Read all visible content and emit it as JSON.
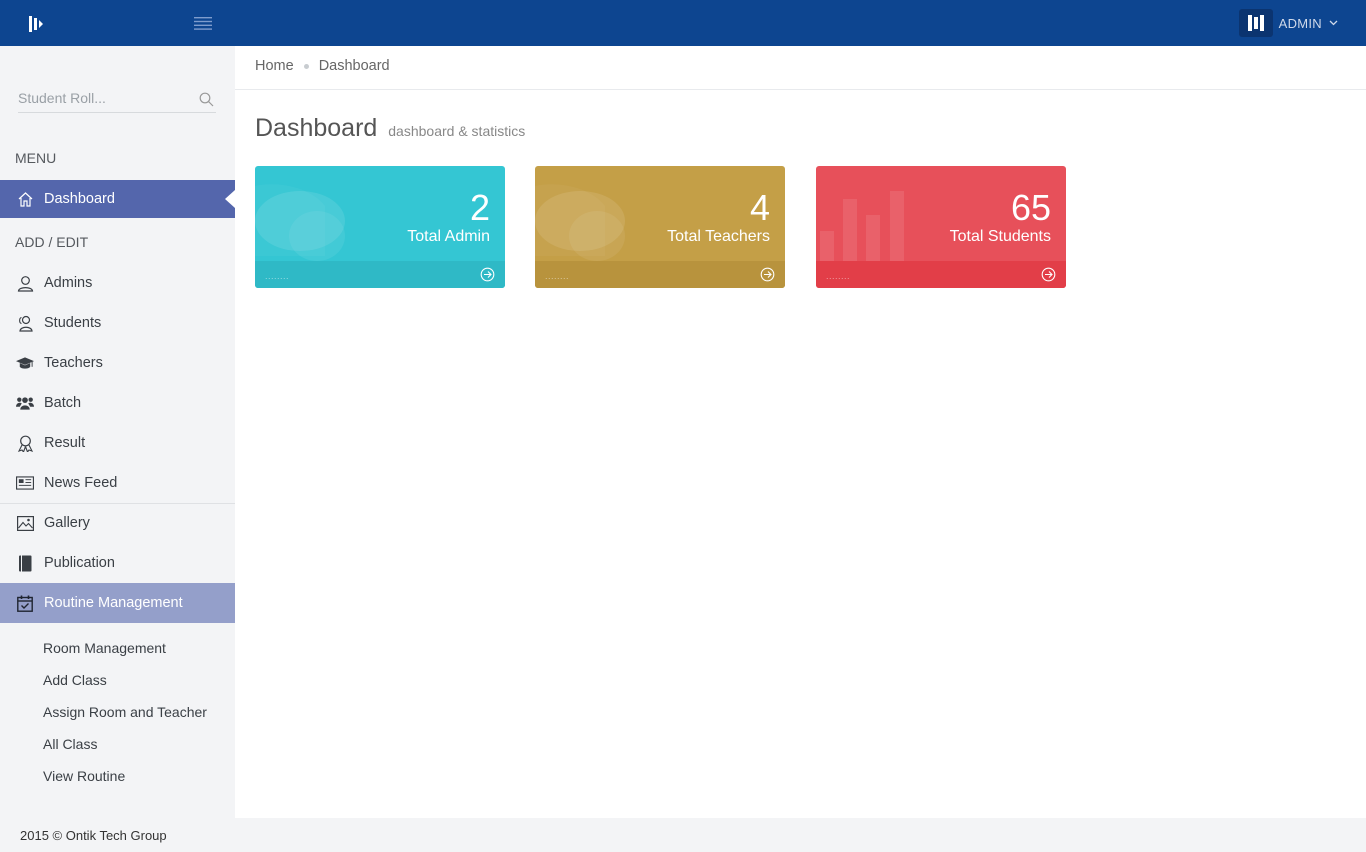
{
  "header": {
    "user_name": "ADMIN",
    "color": "#0d4590"
  },
  "sidebar": {
    "search_placeholder": "Student Roll...",
    "menu_heading": "MENU",
    "add_edit_heading": "ADD / EDIT",
    "items": [
      {
        "label": "Dashboard",
        "icon": "home-icon"
      },
      {
        "label": "Admins",
        "icon": "user-icon"
      },
      {
        "label": "Students",
        "icon": "users-icon"
      },
      {
        "label": "Teachers",
        "icon": "graduation-cap-icon"
      },
      {
        "label": "Batch",
        "icon": "group-icon"
      },
      {
        "label": "Result",
        "icon": "award-icon"
      },
      {
        "label": "News Feed",
        "icon": "newspaper-icon"
      },
      {
        "label": "Gallery",
        "icon": "picture-icon"
      },
      {
        "label": "Publication",
        "icon": "book-icon"
      },
      {
        "label": "Routine Management",
        "icon": "calendar-check-icon"
      }
    ],
    "routine_sub_items": [
      "Room Management",
      "Add Class",
      "Assign Room and Teacher",
      "All Class",
      "View Routine"
    ],
    "active_color": "#5466ac",
    "open_color": "#949fca"
  },
  "main": {
    "breadcrumb": [
      "Home",
      "Dashboard"
    ],
    "title": "Dashboard",
    "subtitle": "dashboard & statistics",
    "cards": [
      {
        "value": "2",
        "label": "Total Admin",
        "color": "#34c6d3",
        "footer_color": "#2fb9c6",
        "dots": "........"
      },
      {
        "value": "4",
        "label": "Total Teachers",
        "color": "#c49f47",
        "footer_color": "#b8933d",
        "dots": "........"
      },
      {
        "value": "65",
        "label": "Total Students",
        "color": "#e7505a",
        "footer_color": "#e23e48",
        "dots": "........"
      }
    ]
  },
  "footer": {
    "text": "2015 © Ontik Tech Group"
  }
}
